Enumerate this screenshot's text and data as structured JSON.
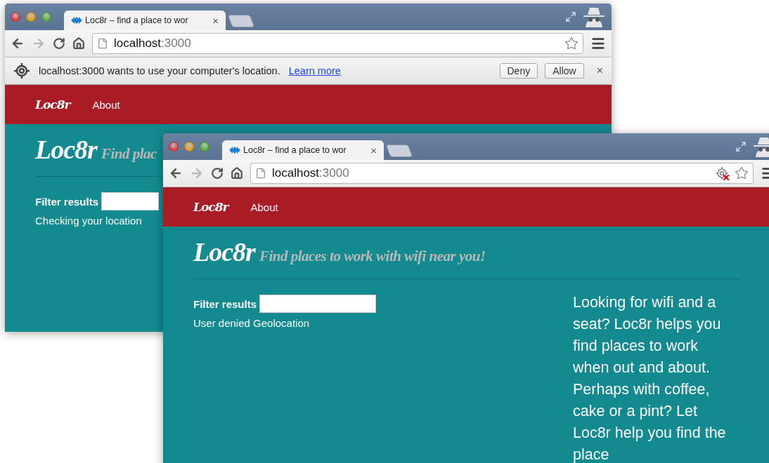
{
  "windows": [
    {
      "tab": {
        "title": "Loc8r – find a place to wor",
        "close": "×"
      },
      "address": {
        "host": "localhost",
        "port": ":3000"
      },
      "location_blocked": false,
      "infobar": {
        "message": "localhost:3000 wants to use your computer's location.",
        "link": "Learn more",
        "buttons": [
          "Deny",
          "Allow"
        ],
        "close": "×"
      },
      "nav": {
        "brand": "Loc8r",
        "links": [
          "About"
        ]
      },
      "page": {
        "title": "Loc8r",
        "tagline": "Find plac",
        "filter_label": "Filter results",
        "status": "Checking your location"
      }
    },
    {
      "tab": {
        "title": "Loc8r – find a place to wor",
        "close": "×"
      },
      "address": {
        "host": "localhost",
        "port": ":3000"
      },
      "location_blocked": true,
      "nav": {
        "brand": "Loc8r",
        "links": [
          "About"
        ]
      },
      "page": {
        "title": "Loc8r",
        "tagline": "Find places to work with wifi near you!",
        "filter_label": "Filter results",
        "status": "User denied Geolocation",
        "sidebar_text": "Looking for wifi and a seat? Loc8r helps you find places to work when out and about. Perhaps with coffee, cake or a pint? Let Loc8r help you find the place"
      }
    }
  ]
}
